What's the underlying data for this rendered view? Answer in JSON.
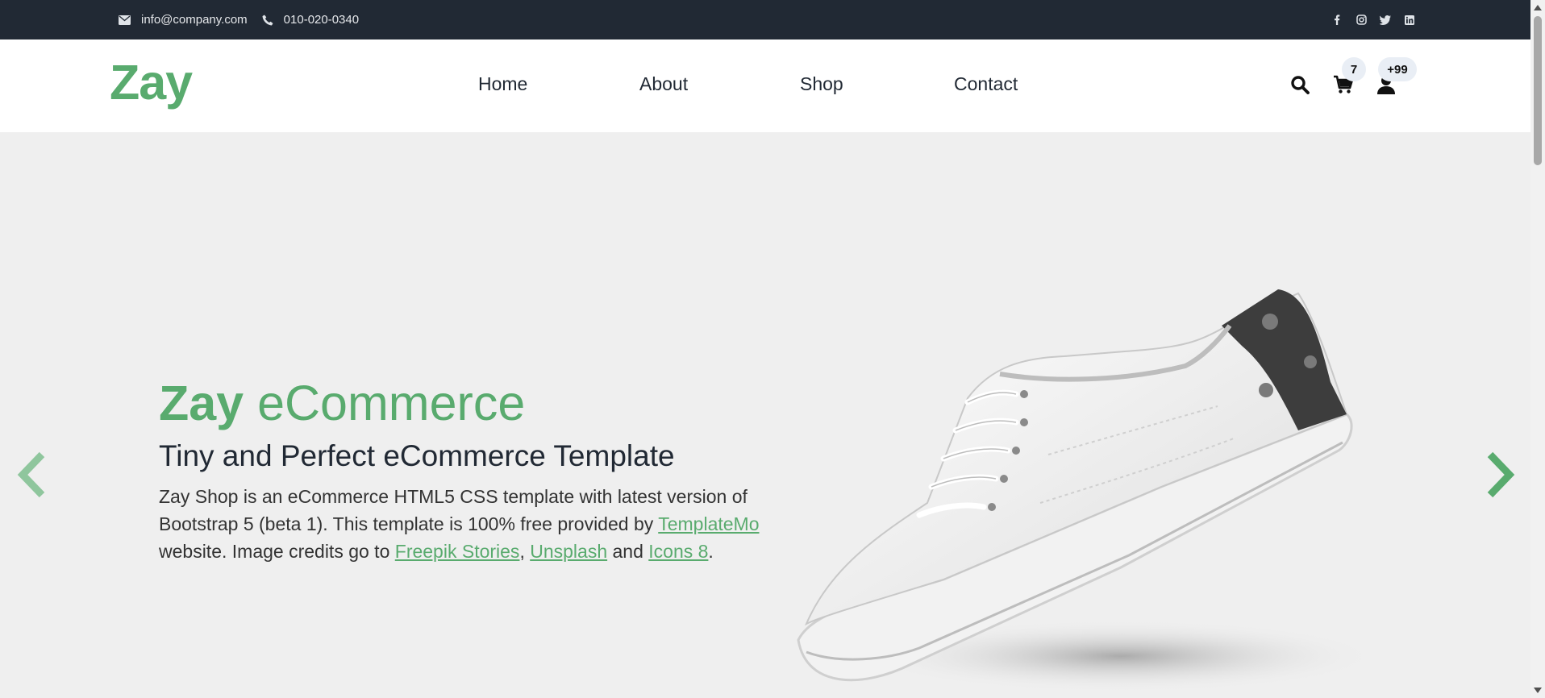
{
  "topbar": {
    "email": "info@company.com",
    "phone": "010-020-0340",
    "social": [
      "facebook-icon",
      "instagram-icon",
      "twitter-icon",
      "linkedin-icon"
    ]
  },
  "nav": {
    "logo": "Zay",
    "links": [
      "Home",
      "About",
      "Shop",
      "Contact"
    ],
    "cart_count": "7",
    "user_count": "+99"
  },
  "hero": {
    "title_bold": "Zay",
    "title_light": "eCommerce",
    "subtitle": "Tiny and Perfect eCommerce Template",
    "text_1": "Zay Shop is an eCommerce HTML5 CSS template with latest version of Bootstrap 5 (beta 1). This template is 100% free provided by ",
    "link_templatemo": "TemplateMo",
    "text_2": " website. Image credits go to ",
    "link_freepik": "Freepik Stories",
    "comma": ", ",
    "link_unsplash": "Unsplash",
    "and": " and ",
    "link_icons8": "Icons 8",
    "period": "."
  },
  "colors": {
    "brand": "#59ab6e",
    "dark": "#212934",
    "hero_bg": "#efefef"
  }
}
